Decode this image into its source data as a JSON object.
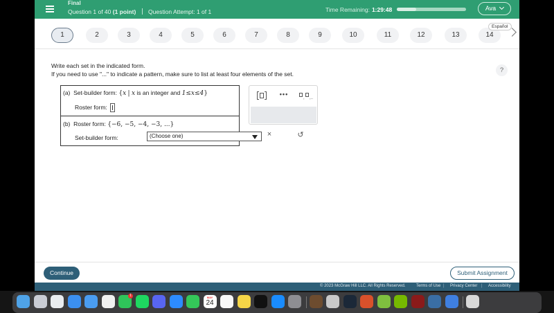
{
  "header": {
    "exam_title": "Final",
    "question_position": "Question 1 of 40",
    "question_points": "(1 point)",
    "attempt_label": "Question Attempt: 1 of 1",
    "time_label": "Time Remaining:",
    "time_value": "1:29:48",
    "time_progress_fraction": 0.28,
    "user_name": "Ava",
    "accent_color": "#2f9e72"
  },
  "question_nav": {
    "buttons": [
      "1",
      "2",
      "3",
      "4",
      "5",
      "6",
      "7",
      "8",
      "9",
      "10",
      "11",
      "12",
      "13",
      "14"
    ],
    "active_index": 0,
    "language_label": "Español"
  },
  "instructions": {
    "line1": "Write each set in the indicated form.",
    "line2": "If you need to use \"...\" to indicate a pattern, make sure to list at least four elements of the set."
  },
  "part_a": {
    "label": "(a)",
    "setbuilder_label": "Set-builder form:",
    "open_brace": "{",
    "var": "x",
    "bar": "|",
    "var2": "x",
    "condition_text": "is an integer and",
    "inequality": "1≤x≤4",
    "close_brace": "}",
    "roster_label": "Roster form:"
  },
  "part_b": {
    "label": "(b)",
    "roster_label": "Roster form:",
    "roster_value": "{−6, −5, −4, −3, ...}",
    "setbuilder_label": "Set-builder form:",
    "select_value": "(Choose one)"
  },
  "palette": {
    "dots_label": "•••",
    "clear_symbol": "×",
    "undo_symbol": "↺"
  },
  "footer_bar": {
    "continue_label": "Continue",
    "submit_label": "Submit Assignment",
    "copyright": "© 2023 McGraw Hill LLC. All Rights Reserved.",
    "terms": "Terms of Use",
    "privacy": "Privacy Center",
    "accessibility": "Accessibility",
    "theme_color": "#2e5f78"
  },
  "dock": {
    "calendar_month": "MAY",
    "calendar_day": "24",
    "facetime_badge": "1",
    "apps": [
      "finder-icon",
      "launchpad-icon",
      "chrome-icon",
      "safari-icon",
      "mail-icon",
      "photos-icon",
      "facetime-icon",
      "spotify-icon",
      "discord-icon",
      "zoom-icon",
      "messages-icon",
      "calendar-icon",
      "reminders-icon",
      "notes-icon",
      "appletv-icon",
      "appstore-icon",
      "system-settings-icon",
      "minecraft-icon",
      "rabbit-game-icon",
      "steam-icon",
      "app-red-icon",
      "app-green-icon",
      "nvidia-icon",
      "dictionary-icon",
      "app-finder-clip-icon",
      "keynote-icon",
      "trash-icon"
    ]
  }
}
